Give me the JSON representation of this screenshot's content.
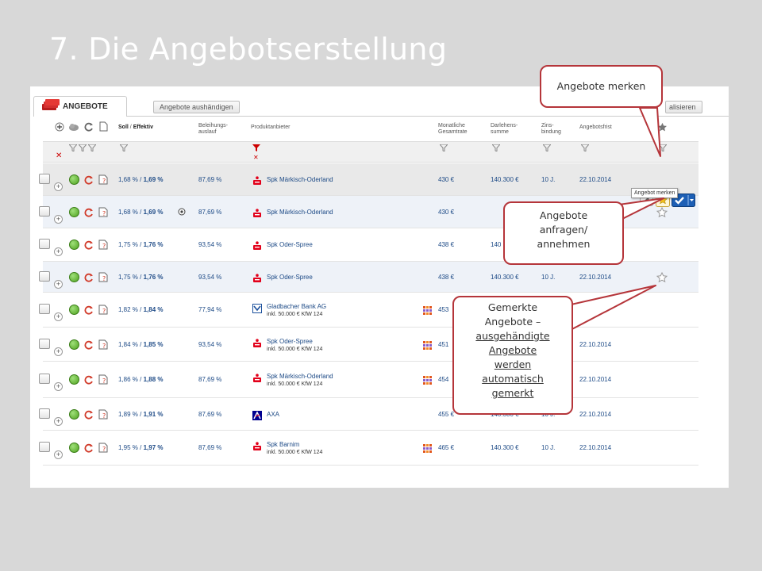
{
  "slide": {
    "title": "7. Die Angebotserstellung"
  },
  "tabs": {
    "active": "ANGEBOTE",
    "handout_button": "Angebote aushändigen",
    "refresh_button": "alisieren"
  },
  "columns": {
    "rate_soll": "Soll",
    "rate_sep": " / ",
    "rate_eff": "Effektiv",
    "ltv": "Beleihungs-\nauslauf",
    "provider": "Produktanbieter",
    "monthly": "Monatliche\nGesamtrate",
    "loan": "Darlehens-\nsumme",
    "fix": "Zins-\nbindung",
    "deadline": "Angebotsfrist"
  },
  "rows": [
    {
      "soll": "1,68 %",
      "eff": "1,69 %",
      "ltv": "87,69 %",
      "bank": "Spk Märkisch-Oderland",
      "sub": "",
      "rate": "430 €",
      "loan": "140.300 €",
      "fix": "10 J.",
      "date": "22.10.2014",
      "icon": "sparkasse"
    },
    {
      "soll": "1,68 %",
      "eff": "1,69 %",
      "ltv": "87,69 %",
      "bank": "Spk Märkisch-Oderland",
      "sub": "",
      "rate": "430 €",
      "loan": "",
      "fix": "",
      "date": "",
      "icon": "sparkasse"
    },
    {
      "soll": "1,75 %",
      "eff": "1,76 %",
      "ltv": "93,54 %",
      "bank": "Spk Oder-Spree",
      "sub": "",
      "rate": "438 €",
      "loan": "140",
      "fix": "",
      "date": "",
      "icon": "sparkasse"
    },
    {
      "soll": "1,75 %",
      "eff": "1,76 %",
      "ltv": "93,54 %",
      "bank": "Spk Oder-Spree",
      "sub": "",
      "rate": "438 €",
      "loan": "140.300 €",
      "fix": "10 J.",
      "date": "22.10.2014",
      "icon": "sparkasse"
    },
    {
      "soll": "1,82 %",
      "eff": "1,84 %",
      "ltv": "77,94 %",
      "bank": "Gladbacher Bank AG",
      "sub": "inkl. 50.000 € KfW 124",
      "rate": "453",
      "loan": "",
      "fix": "",
      "date": "014",
      "icon": "gladbacher"
    },
    {
      "soll": "1,84 %",
      "eff": "1,85 %",
      "ltv": "93,54 %",
      "bank": "Spk Oder-Spree",
      "sub": "inkl. 50.000 € KfW 124",
      "rate": "451",
      "loan": "",
      "fix": "",
      "date": "22.10.2014",
      "icon": "sparkasse"
    },
    {
      "soll": "1,86 %",
      "eff": "1,88 %",
      "ltv": "87,69 %",
      "bank": "Spk Märkisch-Oderland",
      "sub": "inkl. 50.000 € KfW 124",
      "rate": "454",
      "loan": "",
      "fix": "",
      "date": "22.10.2014",
      "icon": "sparkasse"
    },
    {
      "soll": "1,89 %",
      "eff": "1,91 %",
      "ltv": "87,69 %",
      "bank": "AXA",
      "sub": "",
      "rate": "455 €",
      "loan": "140.300 €",
      "fix": "10 J.",
      "date": "22.10.2014",
      "icon": "axa"
    },
    {
      "soll": "1,95 %",
      "eff": "1,97 %",
      "ltv": "87,69 %",
      "bank": "Spk Barnim",
      "sub": "inkl. 50.000 € KfW 124",
      "rate": "465 €",
      "loan": "140.300 €",
      "fix": "10 J.",
      "date": "22.10.2014",
      "icon": "sparkasse"
    }
  ],
  "tooltip": "Angebot merken",
  "callouts": {
    "merken": "Angebote merken",
    "anfragen_1": "Angebote",
    "anfragen_2": "anfragen/",
    "anfragen_3": "annehmen",
    "gemerkt_1": "Gemerkte",
    "gemerkt_2": "Angebote –",
    "gemerkt_3": "ausgehändigte",
    "gemerkt_4": "Angebote",
    "gemerkt_5": "werden",
    "gemerkt_6": "automatisch",
    "gemerkt_7": "gemerkt"
  },
  "colors": {
    "accent_red": "#b5353a",
    "sparkasse_red": "#e2001a",
    "status_green": "#4fa21f",
    "link_blue": "#1d4a86"
  }
}
